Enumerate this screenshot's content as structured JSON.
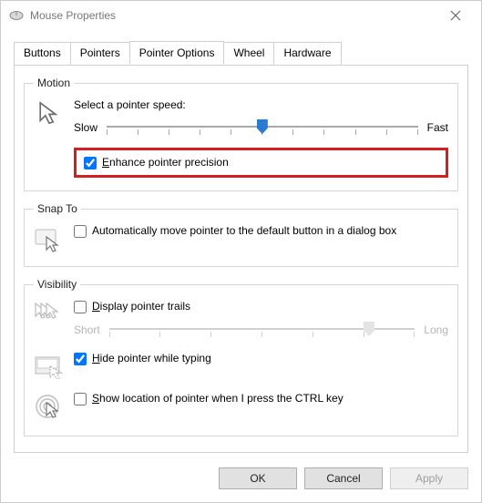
{
  "window": {
    "title": "Mouse Properties"
  },
  "tabs": {
    "items": [
      {
        "label": "Buttons"
      },
      {
        "label": "Pointers"
      },
      {
        "label": "Pointer Options"
      },
      {
        "label": "Wheel"
      },
      {
        "label": "Hardware"
      }
    ],
    "active_index": 2
  },
  "groups": {
    "motion": {
      "legend": "Motion",
      "speed_label": "Select a pointer speed:",
      "slow_label": "Slow",
      "fast_label": "Fast",
      "slider_value_percent": 50,
      "enhance_checked": true,
      "enhance_label_prefix": "E",
      "enhance_label_rest": "nhance pointer precision"
    },
    "snap": {
      "legend": "Snap To",
      "auto_checked": false,
      "auto_label": "Automatically move pointer to the default button in a dialog box"
    },
    "visibility": {
      "legend": "Visibility",
      "trails_checked": false,
      "trails_label_prefix": "D",
      "trails_label_rest": "isplay pointer trails",
      "short_label": "Short",
      "long_label": "Long",
      "trails_slider_value_percent": 85,
      "trails_slider_enabled": false,
      "hide_checked": true,
      "hide_label_prefix": "H",
      "hide_label_rest": "ide pointer while typing",
      "ctrl_checked": false,
      "ctrl_label_prefix": "S",
      "ctrl_label_rest": "how location of pointer when I press the CTRL key"
    }
  },
  "buttons": {
    "ok": "OK",
    "cancel": "Cancel",
    "apply": "Apply",
    "apply_enabled": false
  }
}
